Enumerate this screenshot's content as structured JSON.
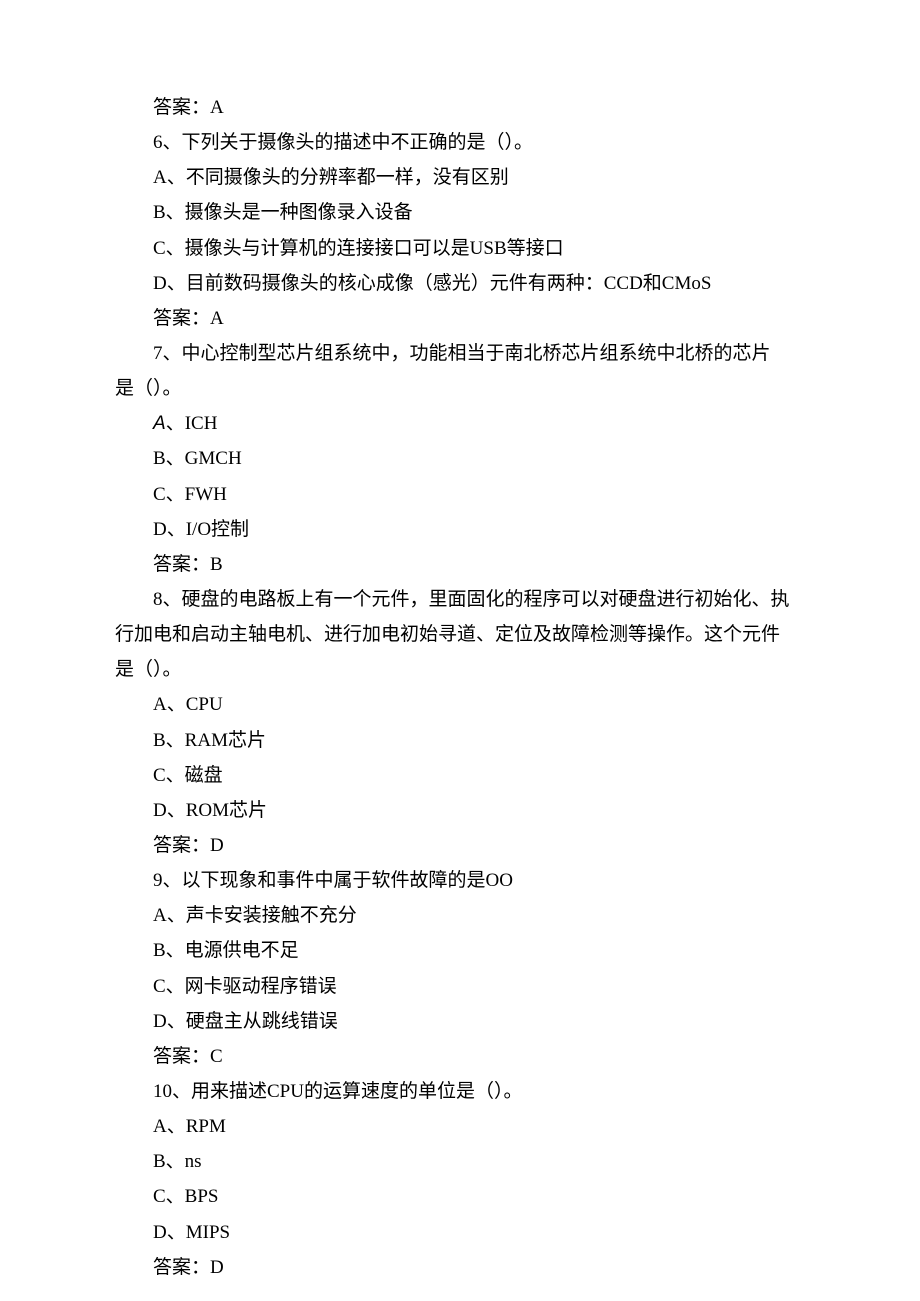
{
  "lines": [
    {
      "text": "答案：A",
      "indent": true
    },
    {
      "text": "6、下列关于摄像头的描述中不正确的是（）。",
      "indent": true
    },
    {
      "text": "A、不同摄像头的分辨率都一样，没有区别",
      "indent": true
    },
    {
      "text": "B、摄像头是一种图像录入设备",
      "indent": true
    },
    {
      "text": "C、摄像头与计算机的连接接口可以是USB等接口",
      "indent": true
    },
    {
      "text": "D、目前数码摄像头的核心成像（感光）元件有两种：CCD和CMoS",
      "indent": true
    },
    {
      "text": "答案：A",
      "indent": true
    },
    {
      "text": "7、中心控制型芯片组系统中，功能相当于南北桥芯片组系统中北桥的芯片",
      "indent": true
    },
    {
      "text": "是（）。",
      "indent": false
    },
    {
      "prefix": "A",
      "prefixItalic": true,
      "text": "、ICH",
      "indent": true
    },
    {
      "text": "B、GMCH",
      "indent": true
    },
    {
      "text": "C、FWH",
      "indent": true
    },
    {
      "text": "D、I/O控制",
      "indent": true
    },
    {
      "text": "答案：B",
      "indent": true
    },
    {
      "text": "8、硬盘的电路板上有一个元件，里面固化的程序可以对硬盘进行初始化、执",
      "indent": true
    },
    {
      "text": "行加电和启动主轴电机、进行加电初始寻道、定位及故障检测等操作。这个元件",
      "indent": false
    },
    {
      "text": "是（）。",
      "indent": false
    },
    {
      "text": "A、CPU",
      "indent": true
    },
    {
      "text": "B、RAM芯片",
      "indent": true
    },
    {
      "text": "C、磁盘",
      "indent": true
    },
    {
      "text": "D、ROM芯片",
      "indent": true
    },
    {
      "text": "答案：D",
      "indent": true
    },
    {
      "text": "9、以下现象和事件中属于软件故障的是OO",
      "indent": true
    },
    {
      "text": "A、声卡安装接触不充分",
      "indent": true
    },
    {
      "text": "B、电源供电不足",
      "indent": true
    },
    {
      "text": "C、网卡驱动程序错误",
      "indent": true
    },
    {
      "text": "D、硬盘主从跳线错误",
      "indent": true
    },
    {
      "text": "答案：C",
      "indent": true
    },
    {
      "text": "10、用来描述CPU的运算速度的单位是（）。",
      "indent": true
    },
    {
      "text": "A、RPM",
      "indent": true
    },
    {
      "text": "B、ns",
      "indent": true
    },
    {
      "text": "C、BPS",
      "indent": true
    },
    {
      "text": "D、MIPS",
      "indent": true
    },
    {
      "text": "答案：D",
      "indent": true
    }
  ]
}
